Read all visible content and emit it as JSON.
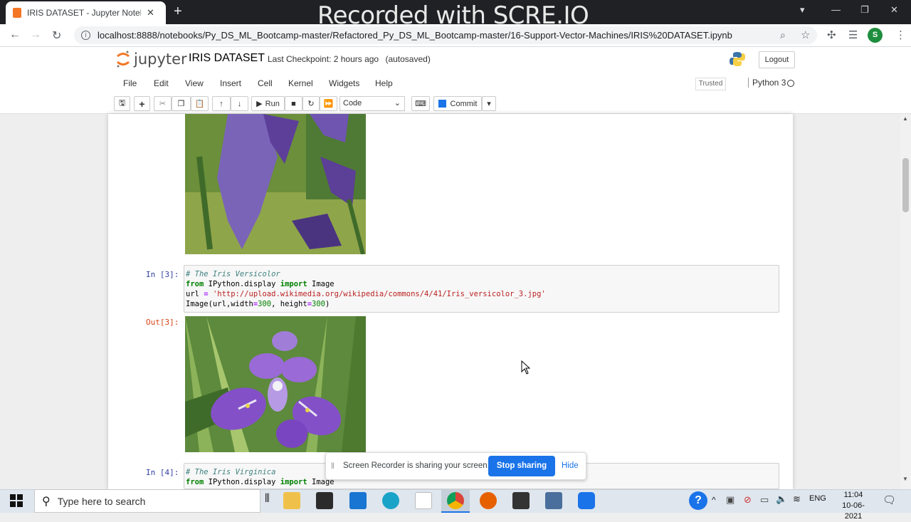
{
  "browser": {
    "tab_title": "IRIS DATASET - Jupyter Notebook",
    "overlay_text": "Recorded with SCRE.IO",
    "url": "localhost:8888/notebooks/Py_DS_ML_Bootcamp-master/Refactored_Py_DS_ML_Bootcamp-master/16-Support-Vector-Machines/IRIS%20DATASET.ipynb",
    "avatar_letter": "S"
  },
  "jupyter": {
    "logo_text": "jupyter",
    "notebook_title": "IRIS DATASET",
    "checkpoint": "Last Checkpoint: 2 hours ago",
    "autosaved": "(autosaved)",
    "logout": "Logout",
    "menu": [
      "File",
      "Edit",
      "View",
      "Insert",
      "Cell",
      "Kernel",
      "Widgets",
      "Help"
    ],
    "trusted": "Trusted",
    "kernel": "Python 3",
    "toolbar": {
      "run": "Run",
      "cell_type": "Code",
      "commit": "Commit"
    }
  },
  "cells": {
    "cell3": {
      "in_prompt": "In [3]:",
      "out_prompt": "Out[3]:",
      "line1": "# The Iris Versicolor",
      "line2_kw1": "from",
      "line2_mid": " IPython.display ",
      "line2_kw2": "import",
      "line2_end": " Image",
      "line3_var": "url ",
      "line3_op": "=",
      "line3_str": " 'http://upload.wikimedia.org/wikipedia/commons/4/41/Iris_versicolor_3.jpg'",
      "line4_a": "Image(url,width",
      "line4_op1": "=",
      "line4_n1": "300",
      "line4_b": ", height",
      "line4_op2": "=",
      "line4_n2": "300",
      "line4_c": ")"
    },
    "cell4": {
      "in_prompt": "In [4]:",
      "line1": "# The Iris Virginica",
      "line2_kw1": "from",
      "line2_mid": " IPython.display ",
      "line2_kw2": "import",
      "line2_end": " Image"
    }
  },
  "share_bar": {
    "message": "Screen Recorder is sharing your screen.",
    "stop": "Stop sharing",
    "hide": "Hide"
  },
  "taskbar": {
    "search_placeholder": "Type here to search",
    "language": "ENG",
    "time": "11:04",
    "date": "10-06-2021"
  },
  "colors": {
    "jupyter_orange": "#f37726",
    "chrome_blue": "#1a73e8",
    "in_prompt": "#303f9f",
    "out_prompt": "#d84315"
  }
}
